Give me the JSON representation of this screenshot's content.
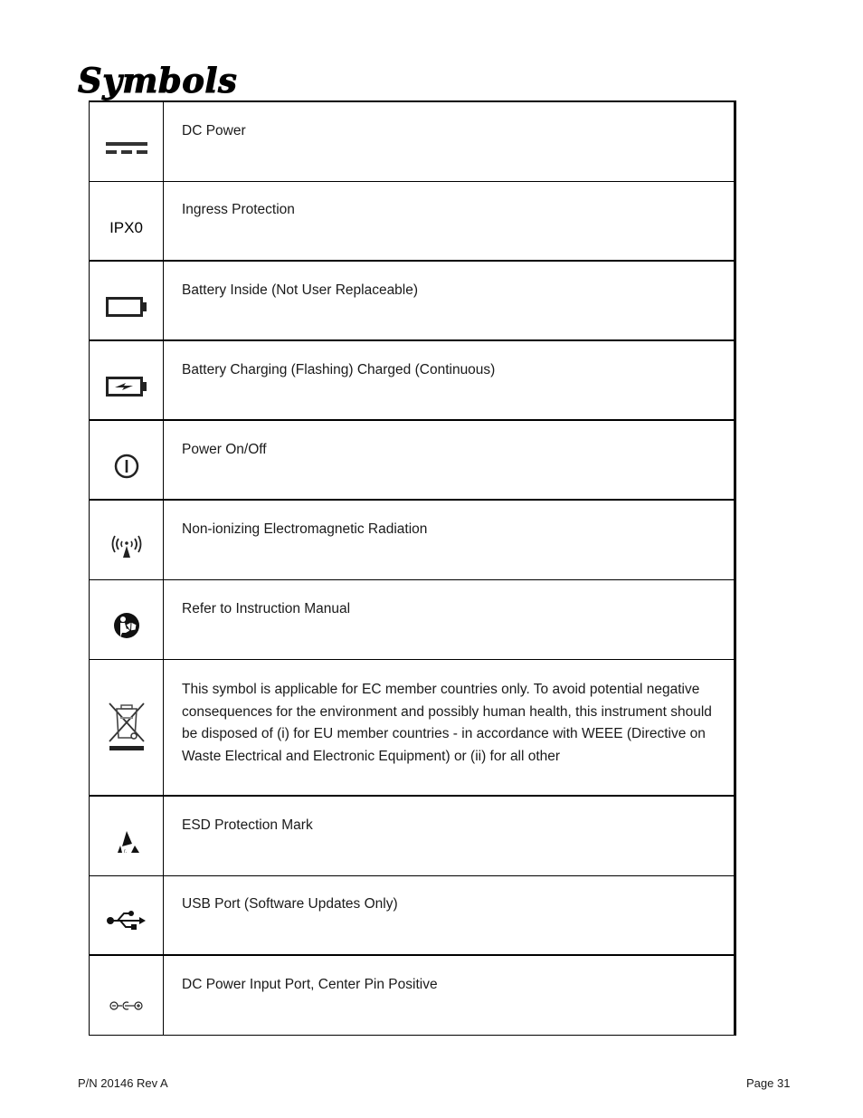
{
  "page": {
    "title": "Symbols",
    "footer": {
      "part_number": "P/N 20146 Rev A",
      "page_label": "Page 31"
    }
  },
  "symbols": [
    {
      "icon": "dc-power-icon",
      "label": "DC Power"
    },
    {
      "icon": "ingress-protection-icon",
      "icon_text": "IPX0",
      "label": "Ingress Protection"
    },
    {
      "icon": "battery-icon",
      "label": "Battery Inside (Not User Replaceable)"
    },
    {
      "icon": "battery-charging-icon",
      "label": "Battery Charging (Flashing) Charged (Continuous)"
    },
    {
      "icon": "power-icon",
      "label": "Power On/Off"
    },
    {
      "icon": "radiation-icon",
      "label": "Non-ionizing Electromagnetic Radiation"
    },
    {
      "icon": "manual-icon",
      "label": "Refer to Instruction Manual"
    },
    {
      "icon": "weee-bin-icon",
      "label": "This symbol is applicable for EC member countries only.   To avoid potential negative consequences for the environment and possibly human health, this instrument should be disposed of (i) for EU member countries - in accordance with WEEE (Directive on Waste Electrical and Electronic Equipment) or (ii) for all other"
    },
    {
      "icon": "esd-icon",
      "label": "ESD Protection Mark"
    },
    {
      "icon": "usb-icon",
      "label": "USB Port (Software Updates Only)"
    },
    {
      "icon": "dc-polarity-icon",
      "label": "DC Power Input Port, Center Pin Positive"
    }
  ]
}
